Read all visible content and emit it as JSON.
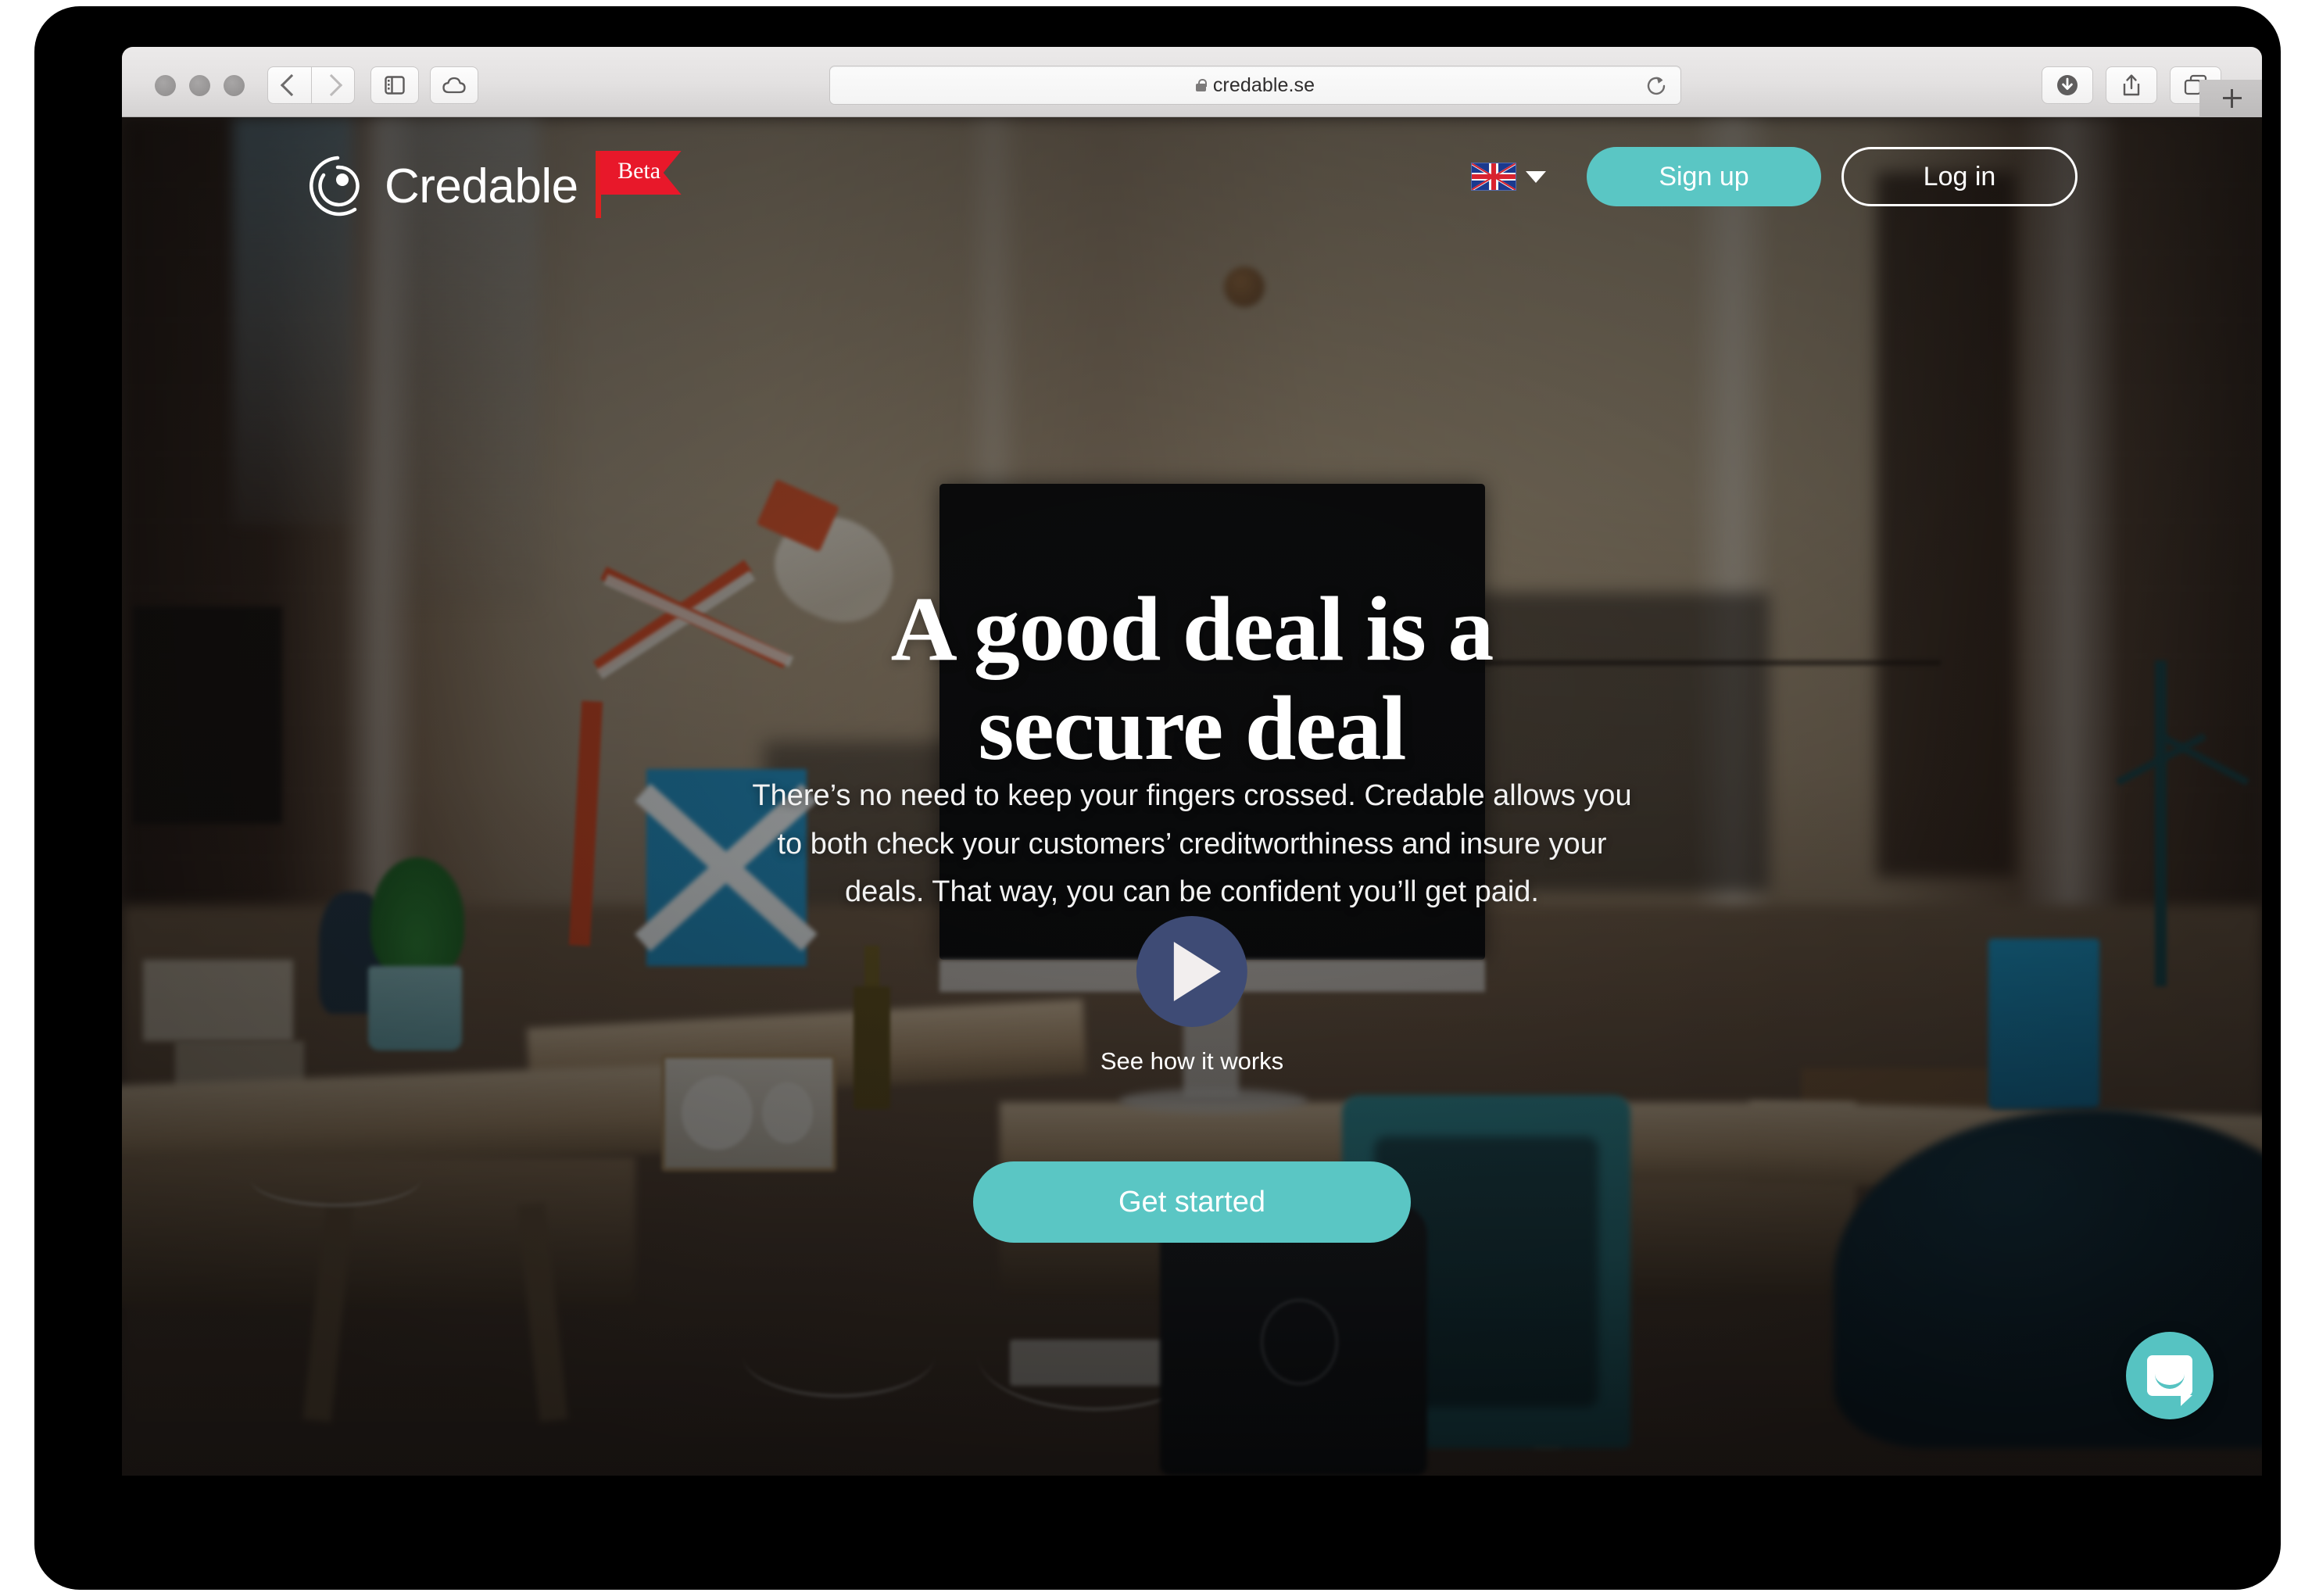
{
  "browser": {
    "url": "credable.se",
    "lock_icon": "lock-icon",
    "traffic_lights": [
      "close",
      "minimize",
      "zoom"
    ],
    "toolbar_icons": [
      "back-chevron-icon",
      "forward-chevron-icon",
      "sidebar-icon",
      "cloud-icon",
      "download-icon",
      "share-icon",
      "tabs-icon",
      "new-tab-plus-icon"
    ],
    "reload_icon": "reload-icon",
    "new_tab_label": "+"
  },
  "header": {
    "logo_mark": "credable-spiral-logo-icon",
    "brand": "Credable",
    "badge": "Beta",
    "language": {
      "flag": "uk-flag-icon",
      "caret": "chevron-down-icon"
    },
    "signup_label": "Sign up",
    "login_label": "Log in"
  },
  "hero": {
    "headline_line1": "A good deal is a",
    "headline_line2": "secure deal",
    "subheading": "There’s no need to keep your fingers crossed. Credable allows you to both check your customers’ creditworthiness and insure your deals. That way, you can be confident you’ll get paid.",
    "play_icon": "play-triangle-icon",
    "play_label": "See how it works",
    "cta_label": "Get started",
    "scroll_icon": "chevron-down-icon"
  },
  "widgets": {
    "chat_icon": "chat-bubble-smile-icon"
  },
  "colors": {
    "accent_teal": "#5ac6c4",
    "play_navy": "#3e4b75",
    "beta_red": "#e8182a",
    "chat_teal": "#56c3c2",
    "text_white": "#ffffff"
  }
}
